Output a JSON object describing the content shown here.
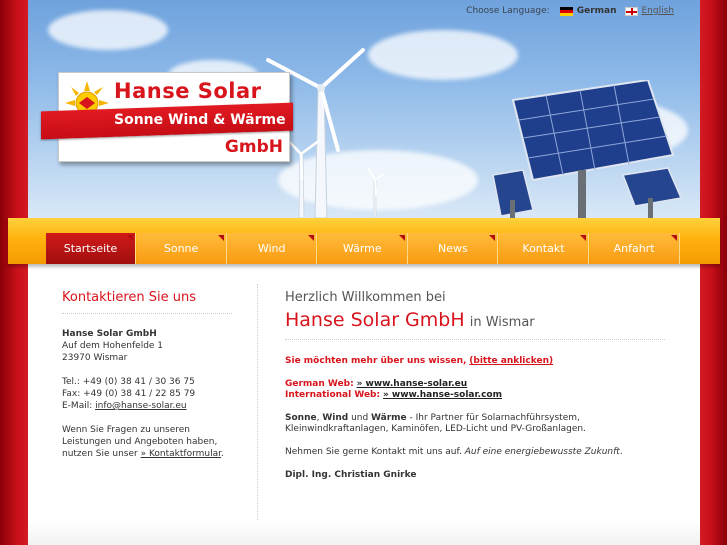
{
  "language_bar": {
    "label": "Choose Language:",
    "german": "German",
    "english": "English"
  },
  "logo": {
    "name": "Hanse Solar",
    "slogan": "Sonne Wind & Wärme",
    "suffix": "GmbH"
  },
  "nav": {
    "items": [
      "Startseite",
      "Sonne",
      "Wind",
      "Wärme",
      "News",
      "Kontakt",
      "Anfahrt"
    ],
    "active": "Startseite"
  },
  "sidebar": {
    "heading": "Kontaktieren Sie uns",
    "company": "Hanse Solar GmbH",
    "street": "Auf dem Hohenfelde 1",
    "city": "23970 Wismar",
    "tel": "Tel.: +49 (0) 38 41 / 30 36 75",
    "fax": "Fax: +49 (0) 38 41 / 22 85 79",
    "email_label": "E-Mail: ",
    "email": "info@hanse-solar.eu",
    "questions_1": "Wenn Sie Fragen zu unseren",
    "questions_2": "Leistungen und Angeboten haben,",
    "questions_3": "nutzen Sie unser ",
    "contact_form_link": "» Kontaktformular",
    "questions_end": "."
  },
  "main": {
    "welcome": "Herzlich Willkommen bei",
    "company": "Hanse Solar GmbH",
    "city": "in Wismar",
    "more_text": "Sie möchten mehr über uns wissen,",
    "more_link": "(bitte anklicken)",
    "german_web_label": "German Web:",
    "german_web_link": "» www.hanse-solar.eu",
    "intl_web_label": "International Web:",
    "intl_web_link": "» www.hanse-solar.com",
    "intro_sonne": "Sonne",
    "intro_sep1": ", ",
    "intro_wind": "Wind",
    "intro_sep2": " und ",
    "intro_waerme": "Wärme",
    "intro_rest": " - Ihr Partner für Solarnachführsystem, Kleinwindkraftanlagen, Kaminöfen, LED-Licht und PV-Großanlagen.",
    "contact_text": "Nehmen Sie gerne Kontakt mit uns auf. ",
    "contact_italic": "Auf eine energiebewusste Zukunft",
    "contact_end": ".",
    "signature": "Dipl. Ing. Christian Gnirke"
  },
  "colors": {
    "brand_red": "#d8141c",
    "nav_orange": "#f99a12",
    "nav_active": "#b30d12"
  }
}
